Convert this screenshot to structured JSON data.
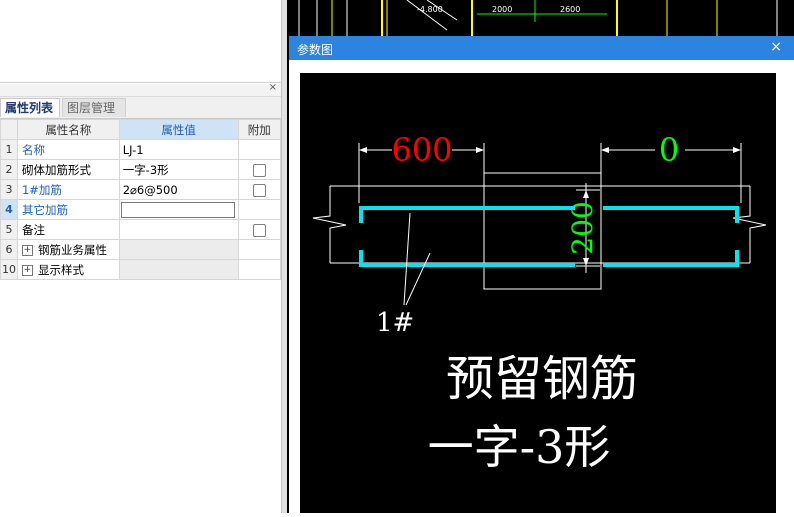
{
  "panel": {
    "close_symbol": "×",
    "tabs": [
      {
        "label": "属性列表",
        "active": true
      },
      {
        "label": "图层管理",
        "active": false
      }
    ],
    "columns": [
      "",
      "属性名称",
      "属性值",
      "附加"
    ],
    "rows": [
      {
        "num": "1",
        "name": "名称",
        "value": "LJ-1",
        "name_color": "blue",
        "checkbox": false
      },
      {
        "num": "2",
        "name": "砌体加筋形式",
        "value": "一字-3形",
        "checkbox": true
      },
      {
        "num": "3",
        "name": "1#加筋",
        "value": "2⌀6@500",
        "name_color": "blue",
        "checkbox": true
      },
      {
        "num": "4",
        "name": "其它加筋",
        "value": "",
        "name_color": "blue",
        "editing": true,
        "checkbox": false
      },
      {
        "num": "5",
        "name": "备注",
        "value": "",
        "checkbox": true
      },
      {
        "num": "6",
        "name": "钢筋业务属性",
        "value": "",
        "expandable": true
      },
      {
        "num": "10",
        "name": "显示样式",
        "value": "",
        "expandable": true
      }
    ]
  },
  "background_cad": {
    "labels": [
      "-4.800",
      "2000",
      "2600"
    ]
  },
  "dialog": {
    "title": "参数图",
    "close_symbol": "×",
    "drawing": {
      "dim_left": "600",
      "dim_right": "0",
      "dim_vertical": "200",
      "rebar_label": "1#",
      "caption_line1": "预留钢筋",
      "caption_line2": "一字-3形",
      "colors": {
        "dim_left": "#ff0000",
        "dim_right": "#00ff00",
        "dim_vertical": "#00ff00",
        "rebar": "#00e5ee",
        "lines": "#ffffff"
      }
    }
  }
}
